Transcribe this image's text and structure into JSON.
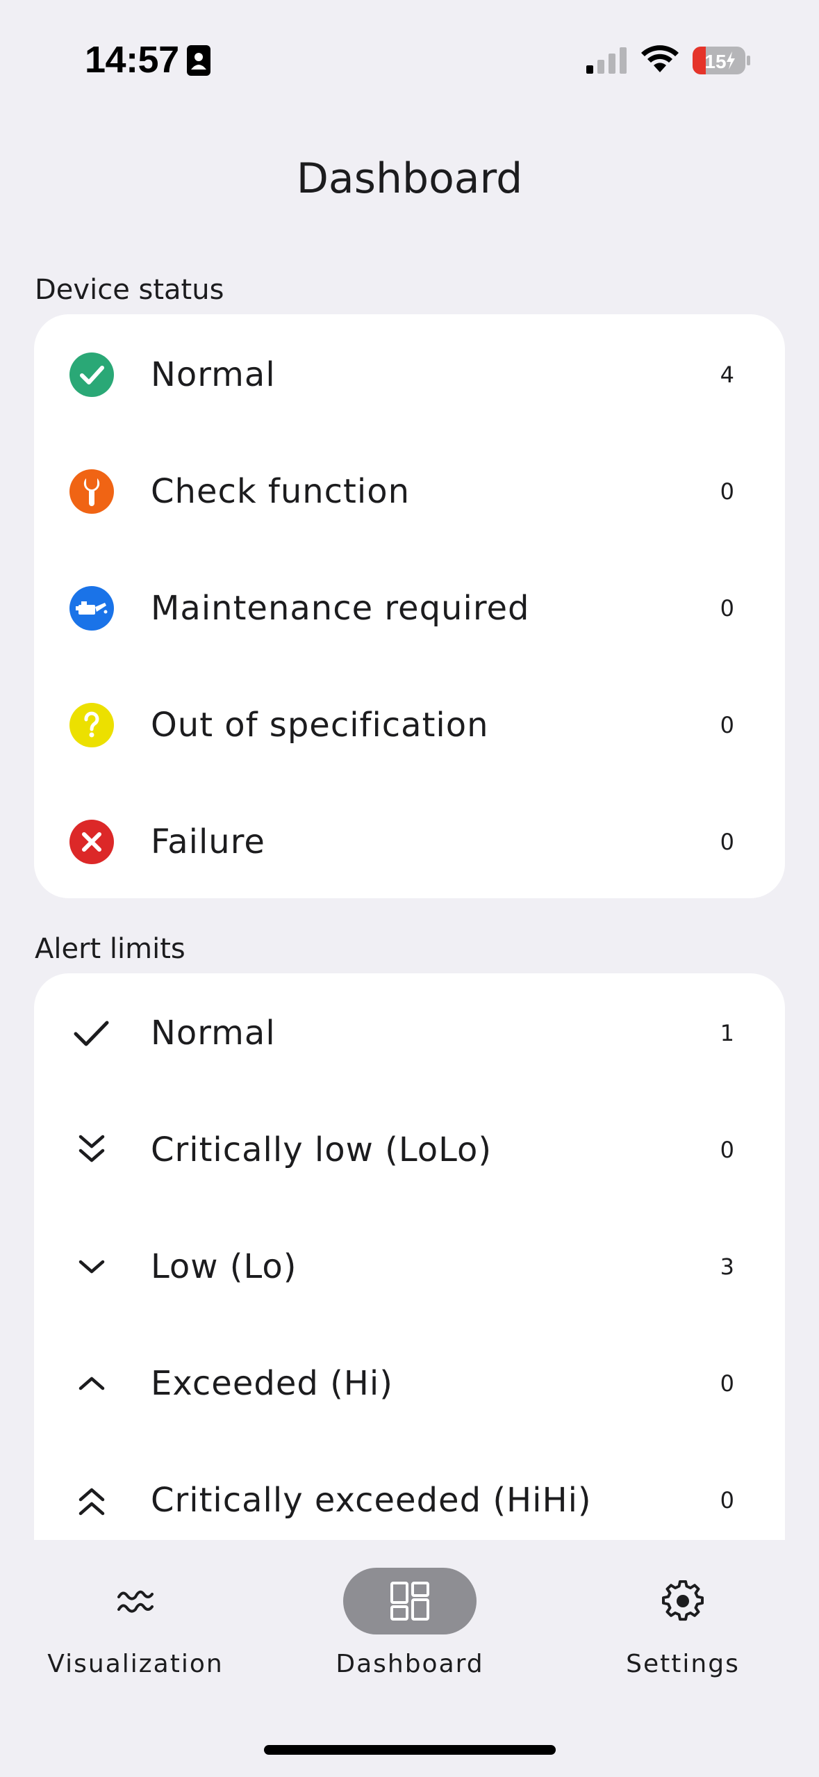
{
  "status_bar": {
    "time": "14:57",
    "battery_level": "15"
  },
  "header": {
    "title": "Dashboard"
  },
  "device_status": {
    "heading": "Device status",
    "items": [
      {
        "label": "Normal",
        "count": "4",
        "icon": "check-circle-icon",
        "color": "#2aa876"
      },
      {
        "label": "Check function",
        "count": "0",
        "icon": "wrench-icon",
        "color": "#f06414"
      },
      {
        "label": "Maintenance required",
        "count": "0",
        "icon": "oil-can-icon",
        "color": "#1a73e8"
      },
      {
        "label": "Out of specification",
        "count": "0",
        "icon": "question-icon",
        "color": "#f0e000"
      },
      {
        "label": "Failure",
        "count": "0",
        "icon": "x-circle-icon",
        "color": "#dc2828"
      }
    ]
  },
  "alert_limits": {
    "heading": "Alert limits",
    "items": [
      {
        "label": "Normal",
        "count": "1",
        "icon": "check-icon"
      },
      {
        "label": "Critically low (LoLo)",
        "count": "0",
        "icon": "double-chevron-down-icon"
      },
      {
        "label": "Low (Lo)",
        "count": "3",
        "icon": "chevron-down-icon"
      },
      {
        "label": "Exceeded (Hi)",
        "count": "0",
        "icon": "chevron-up-icon"
      },
      {
        "label": "Critically exceeded (HiHi)",
        "count": "0",
        "icon": "double-chevron-up-icon"
      }
    ]
  },
  "bottom_nav": {
    "items": [
      {
        "label": "Visualization",
        "icon": "waveform-icon",
        "active": false
      },
      {
        "label": "Dashboard",
        "icon": "dashboard-grid-icon",
        "active": true
      },
      {
        "label": "Settings",
        "icon": "gear-icon",
        "active": false
      }
    ]
  }
}
